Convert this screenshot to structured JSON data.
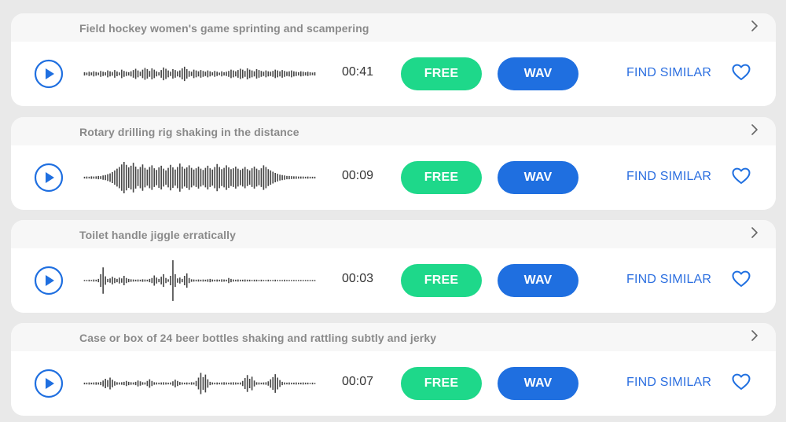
{
  "accent_blue": "#1f6fe0",
  "free_green": "#1ed88a",
  "sounds": [
    {
      "title": "Field hockey women's game sprinting and scampering",
      "duration": "00:41",
      "free_label": "FREE",
      "wav_label": "WAV",
      "find_similar_label": "FIND SIMILAR",
      "waveform": [
        0.08,
        0.06,
        0.1,
        0.07,
        0.12,
        0.09,
        0.06,
        0.14,
        0.1,
        0.08,
        0.16,
        0.12,
        0.09,
        0.18,
        0.11,
        0.07,
        0.2,
        0.14,
        0.1,
        0.08,
        0.12,
        0.18,
        0.24,
        0.16,
        0.1,
        0.2,
        0.28,
        0.22,
        0.14,
        0.26,
        0.2,
        0.12,
        0.08,
        0.18,
        0.3,
        0.24,
        0.16,
        0.1,
        0.22,
        0.18,
        0.12,
        0.16,
        0.26,
        0.34,
        0.22,
        0.14,
        0.1,
        0.2,
        0.16,
        0.12,
        0.18,
        0.14,
        0.1,
        0.16,
        0.12,
        0.08,
        0.14,
        0.1,
        0.06,
        0.12,
        0.08,
        0.1,
        0.14,
        0.2,
        0.16,
        0.12,
        0.18,
        0.24,
        0.2,
        0.14,
        0.26,
        0.2,
        0.16,
        0.12,
        0.22,
        0.18,
        0.14,
        0.1,
        0.16,
        0.12,
        0.1,
        0.14,
        0.2,
        0.16,
        0.12,
        0.18,
        0.14,
        0.1,
        0.12,
        0.16,
        0.12,
        0.1,
        0.08,
        0.12,
        0.1,
        0.08,
        0.1,
        0.08,
        0.06,
        0.08
      ]
    },
    {
      "title": "Rotary drilling rig shaking in the distance",
      "duration": "00:09",
      "free_label": "FREE",
      "wav_label": "WAV",
      "find_similar_label": "FIND SIMILAR",
      "waveform": [
        0.04,
        0.05,
        0.04,
        0.06,
        0.05,
        0.06,
        0.08,
        0.07,
        0.1,
        0.12,
        0.16,
        0.2,
        0.26,
        0.34,
        0.42,
        0.5,
        0.62,
        0.74,
        0.6,
        0.48,
        0.56,
        0.7,
        0.52,
        0.4,
        0.5,
        0.62,
        0.46,
        0.38,
        0.5,
        0.58,
        0.44,
        0.36,
        0.48,
        0.56,
        0.42,
        0.34,
        0.46,
        0.6,
        0.48,
        0.38,
        0.5,
        0.66,
        0.52,
        0.42,
        0.48,
        0.58,
        0.46,
        0.38,
        0.44,
        0.52,
        0.42,
        0.36,
        0.46,
        0.56,
        0.44,
        0.38,
        0.5,
        0.64,
        0.5,
        0.4,
        0.46,
        0.58,
        0.48,
        0.4,
        0.44,
        0.52,
        0.42,
        0.36,
        0.42,
        0.5,
        0.4,
        0.34,
        0.44,
        0.52,
        0.42,
        0.36,
        0.44,
        0.58,
        0.5,
        0.4,
        0.34,
        0.28,
        0.22,
        0.18,
        0.14,
        0.12,
        0.1,
        0.08,
        0.08,
        0.07,
        0.06,
        0.06,
        0.05,
        0.05,
        0.05,
        0.04,
        0.05,
        0.04,
        0.04,
        0.04
      ]
    },
    {
      "title": "Toilet handle jiggle erratically",
      "duration": "00:03",
      "free_label": "FREE",
      "wav_label": "WAV",
      "find_similar_label": "FIND SIMILAR",
      "waveform": [
        0.03,
        0.03,
        0.04,
        0.03,
        0.05,
        0.04,
        0.08,
        0.3,
        0.62,
        0.2,
        0.08,
        0.1,
        0.18,
        0.12,
        0.08,
        0.14,
        0.1,
        0.22,
        0.12,
        0.08,
        0.06,
        0.05,
        0.04,
        0.05,
        0.04,
        0.06,
        0.05,
        0.04,
        0.08,
        0.12,
        0.24,
        0.14,
        0.08,
        0.18,
        0.3,
        0.12,
        0.06,
        0.22,
        0.96,
        0.3,
        0.1,
        0.14,
        0.08,
        0.22,
        0.34,
        0.12,
        0.06,
        0.05,
        0.04,
        0.05,
        0.04,
        0.05,
        0.04,
        0.06,
        0.08,
        0.05,
        0.04,
        0.05,
        0.04,
        0.06,
        0.05,
        0.04,
        0.12,
        0.08,
        0.05,
        0.04,
        0.05,
        0.04,
        0.04,
        0.05,
        0.04,
        0.04,
        0.03,
        0.04,
        0.04,
        0.03,
        0.04,
        0.03,
        0.03,
        0.04,
        0.03,
        0.03,
        0.04,
        0.03,
        0.03,
        0.03,
        0.04,
        0.03,
        0.03,
        0.03,
        0.03,
        0.03,
        0.03,
        0.03,
        0.03,
        0.03,
        0.03,
        0.03,
        0.03,
        0.03
      ]
    },
    {
      "title": "Case or box of 24 beer bottles shaking and rattling subtly and jerky",
      "duration": "00:07",
      "free_label": "FREE",
      "wav_label": "WAV",
      "find_similar_label": "FIND SIMILAR",
      "waveform": [
        0.04,
        0.04,
        0.05,
        0.04,
        0.05,
        0.06,
        0.05,
        0.08,
        0.14,
        0.22,
        0.16,
        0.28,
        0.18,
        0.1,
        0.06,
        0.05,
        0.06,
        0.08,
        0.12,
        0.08,
        0.06,
        0.05,
        0.08,
        0.14,
        0.1,
        0.06,
        0.05,
        0.12,
        0.2,
        0.12,
        0.06,
        0.05,
        0.04,
        0.05,
        0.06,
        0.05,
        0.04,
        0.05,
        0.1,
        0.18,
        0.12,
        0.07,
        0.05,
        0.04,
        0.05,
        0.04,
        0.06,
        0.05,
        0.12,
        0.28,
        0.5,
        0.3,
        0.42,
        0.2,
        0.08,
        0.05,
        0.04,
        0.05,
        0.04,
        0.05,
        0.06,
        0.05,
        0.04,
        0.05,
        0.06,
        0.05,
        0.04,
        0.05,
        0.12,
        0.26,
        0.4,
        0.22,
        0.32,
        0.14,
        0.06,
        0.05,
        0.04,
        0.05,
        0.06,
        0.1,
        0.2,
        0.3,
        0.44,
        0.28,
        0.16,
        0.08,
        0.05,
        0.04,
        0.05,
        0.04,
        0.04,
        0.05,
        0.04,
        0.04,
        0.05,
        0.04,
        0.04,
        0.03,
        0.04,
        0.03
      ]
    }
  ]
}
